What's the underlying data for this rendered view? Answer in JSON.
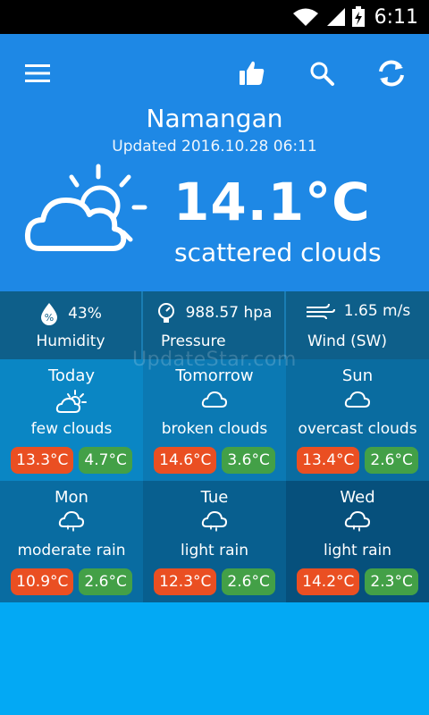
{
  "status_bar": {
    "time": "6:11"
  },
  "app_bar": {
    "icons": [
      "menu-icon",
      "thumbs-up-icon",
      "search-icon",
      "refresh-icon"
    ]
  },
  "current": {
    "city": "Namangan",
    "updated": "Updated 2016.10.28 06:11",
    "temperature": "14.1°C",
    "condition": "scattered clouds",
    "icon": "partly-cloudy-icon"
  },
  "stats": {
    "humidity": {
      "value": "43%",
      "label": "Humidity",
      "icon": "humidity-drop-icon"
    },
    "pressure": {
      "value": "988.57 hpa",
      "label": "Pressure",
      "icon": "barometer-icon"
    },
    "wind": {
      "value": "1.65 m/s",
      "label": "Wind (SW)",
      "icon": "wind-icon"
    }
  },
  "watermark": "UpdateStar.com",
  "forecast": [
    {
      "day": "Today",
      "desc": "few clouds",
      "high": "13.3°C",
      "low": "4.7°C",
      "icon": "sun-cloud-icon"
    },
    {
      "day": "Tomorrow",
      "desc": "broken clouds",
      "high": "14.6°C",
      "low": "3.6°C",
      "icon": "cloud-icon"
    },
    {
      "day": "Sun",
      "desc": "overcast clouds",
      "high": "13.4°C",
      "low": "2.6°C",
      "icon": "cloud-icon"
    },
    {
      "day": "Mon",
      "desc": "moderate rain",
      "high": "10.9°C",
      "low": "2.6°C",
      "icon": "rain-cloud-icon"
    },
    {
      "day": "Tue",
      "desc": "light rain",
      "high": "12.3°C",
      "low": "2.6°C",
      "icon": "rain-cloud-icon"
    },
    {
      "day": "Wed",
      "desc": "light rain",
      "high": "14.2°C",
      "low": "2.3°C",
      "icon": "rain-cloud-icon"
    }
  ],
  "colors": {
    "header_blue": "#1e88e5",
    "stats_dark": "#0e5f8a",
    "high_badge": "#ea4f22",
    "low_badge": "#43a047",
    "background": "#03a9f4"
  }
}
